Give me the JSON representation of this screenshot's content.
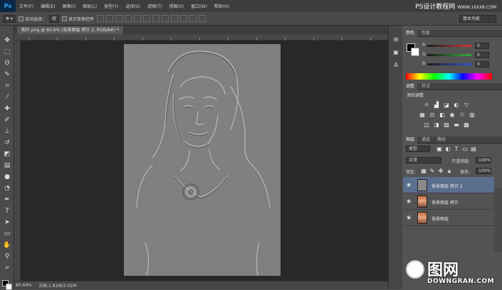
{
  "app": {
    "logo": "Ps"
  },
  "menu": [
    "文件(F)",
    "编辑(E)",
    "图像(I)",
    "图层(L)",
    "类型(Y)",
    "选择(S)",
    "滤镜(T)",
    "视图(V)",
    "窗口(W)",
    "帮助(H)"
  ],
  "watermark_top": {
    "site": "PS设计教程网",
    "url": "WWW.16XX8.COM"
  },
  "options": {
    "auto_select_label": "自动选择：",
    "auto_select_value": "组",
    "show_transform_label": "显示变换控件"
  },
  "workspace": "基本功能",
  "document_tab": "图片.png @ 80.6% (背景图层 拷贝 2, RGB/8#) *",
  "status": {
    "zoom": "80.64%",
    "doc": "文档:1.81M/3.02M"
  },
  "color_panel": {
    "tabs": [
      "颜色",
      "色板"
    ],
    "sliders": [
      {
        "label": "R",
        "value": "0",
        "color": "#d43a3a"
      },
      {
        "label": "G",
        "value": "0",
        "color": "#2fae3c"
      },
      {
        "label": "B",
        "value": "0",
        "color": "#3455d1"
      }
    ]
  },
  "adjustments_panel": {
    "tabs": [
      "调整",
      "样式"
    ],
    "title": "添加调整"
  },
  "layers_panel": {
    "tabs": [
      "图层",
      "通道",
      "路径"
    ],
    "kind": "类型",
    "blend_mode": "正常",
    "opacity_label": "不透明度:",
    "opacity": "100%",
    "lock_label": "锁定:",
    "fill_label": "填充:",
    "fill": "100%",
    "layers": [
      {
        "name": "背景图层 拷贝 2",
        "selected": true,
        "thumb": "gray"
      },
      {
        "name": "背景图层 拷贝",
        "selected": false,
        "thumb": "photo"
      },
      {
        "name": "背景图层",
        "selected": false,
        "thumb": "photo"
      }
    ]
  },
  "watermark_bottom": {
    "cn": "图网",
    "en": "DOWNGRAN.COM"
  }
}
